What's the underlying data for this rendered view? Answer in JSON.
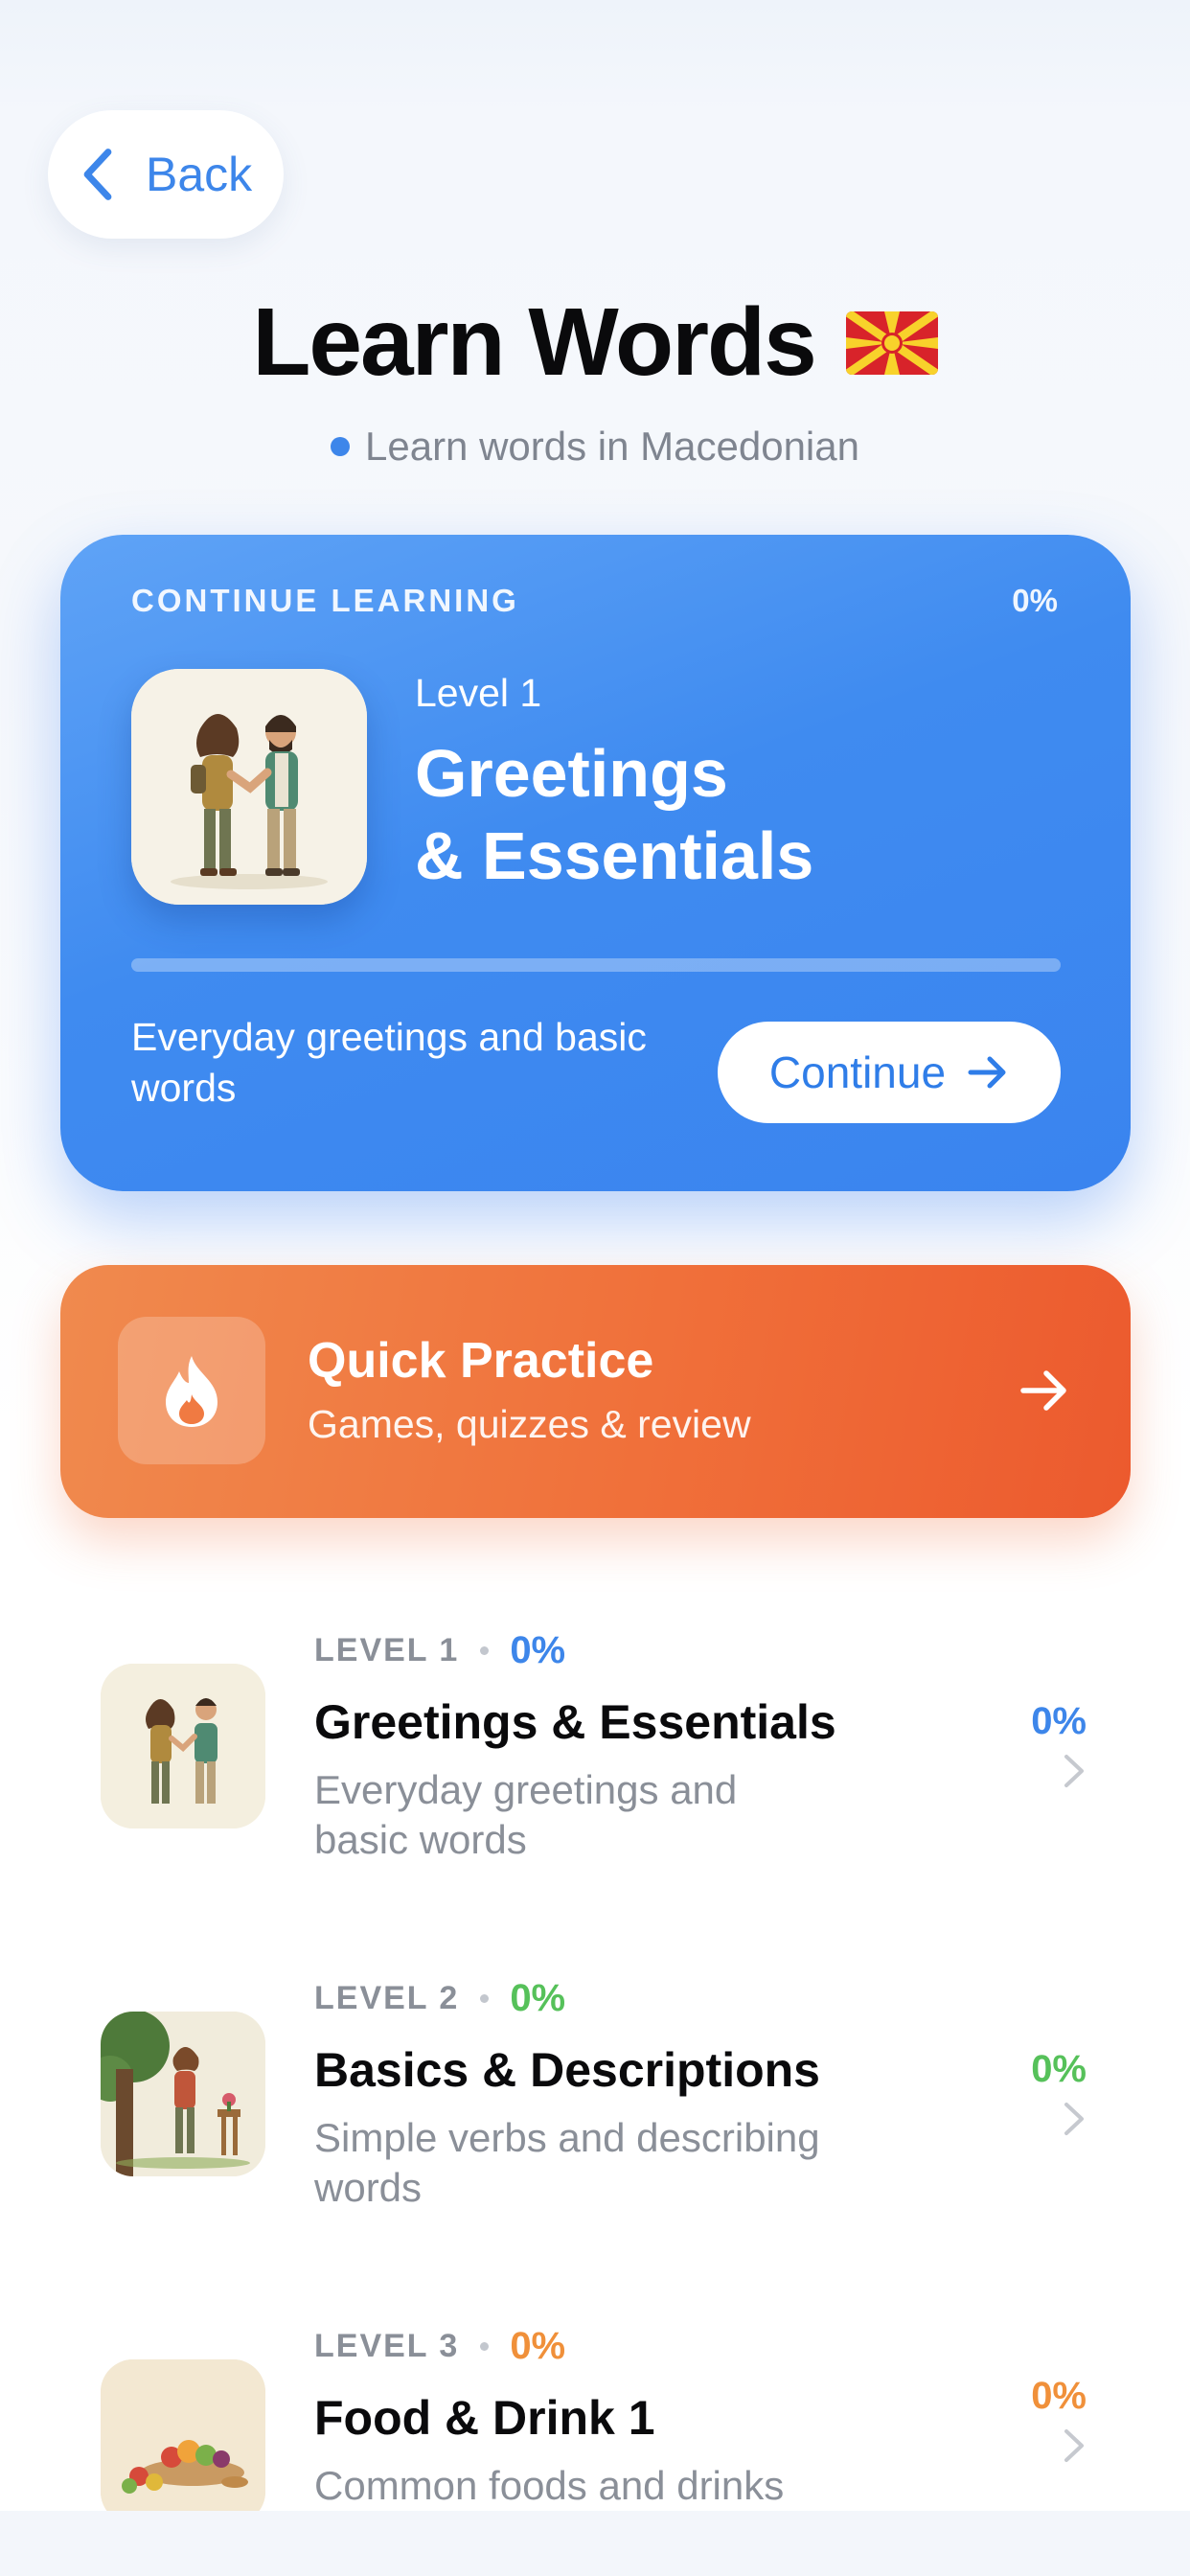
{
  "header": {
    "back_label": "Back",
    "title": "Learn Words",
    "flag": "macedonia-flag",
    "subtitle": "Learn words in Macedonian"
  },
  "continue_card": {
    "eyebrow": "CONTINUE LEARNING",
    "percent": "0%",
    "level": "Level 1",
    "name": "Greetings\n& Essentials",
    "progress": 0,
    "description": "Everyday greetings and basic words",
    "button_label": "Continue"
  },
  "quick_practice": {
    "title": "Quick Practice",
    "subtitle": "Games, quizzes & review",
    "icon": "flame-icon"
  },
  "levels": [
    {
      "level": "LEVEL 1",
      "percent": "0%",
      "name": "Greetings & Essentials",
      "description": "Everyday greetings and basic words",
      "right_percent": "0%",
      "color": "#3d86ea"
    },
    {
      "level": "LEVEL 2",
      "percent": "0%",
      "name": "Basics & Descriptions",
      "description": "Simple verbs and describing words",
      "right_percent": "0%",
      "color": "#56c15a"
    },
    {
      "level": "LEVEL 3",
      "percent": "0%",
      "name": "Food & Drink 1",
      "description": "Common foods and drinks",
      "right_percent": "0%",
      "color": "#f0903a"
    }
  ]
}
